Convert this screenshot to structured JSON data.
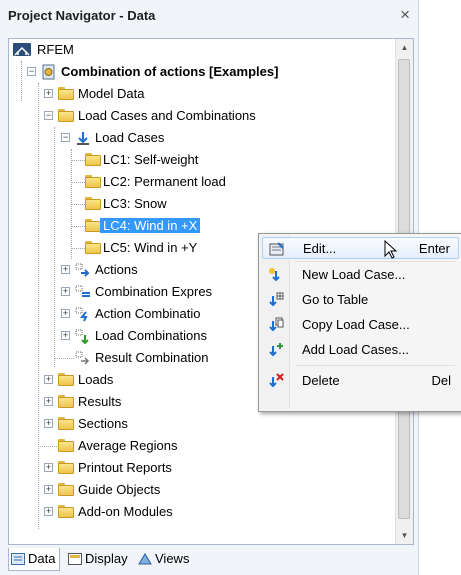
{
  "navigator": {
    "title": "Project Navigator - Data",
    "close_glyph": "×",
    "tree": {
      "root": "RFEM",
      "project": "Combination of actions [Examples]",
      "model_data": "Model Data",
      "lcc": "Load Cases and Combinations",
      "load_cases": "Load Cases",
      "lc1": "LC1: Self-weight",
      "lc2": "LC2: Permanent load",
      "lc3": "LC3: Snow",
      "lc4": "LC4: Wind in +X",
      "lc5": "LC5: Wind in +Y",
      "actions": "Actions",
      "comb_expr": "Combination Expres",
      "action_comb": "Action Combinatio",
      "load_comb": "Load Combinations",
      "result_comb": "Result Combination",
      "loads": "Loads",
      "results": "Results",
      "sections": "Sections",
      "avg_regions": "Average Regions",
      "printout": "Printout Reports",
      "guide": "Guide Objects",
      "addons": "Add-on Modules"
    },
    "tabs": [
      "Data",
      "Display",
      "Views"
    ]
  },
  "context_menu": {
    "edit": "Edit...",
    "edit_shortcut": "Enter",
    "new_lc": "New Load Case...",
    "go_table": "Go to Table",
    "copy_lc": "Copy Load Case...",
    "add_lcs": "Add Load Cases...",
    "delete": "Delete",
    "delete_shortcut": "Del"
  },
  "colors": {
    "selection": "#3399ff",
    "folder": "#f3cd5a",
    "accent_blue": "#1f6fd0"
  }
}
